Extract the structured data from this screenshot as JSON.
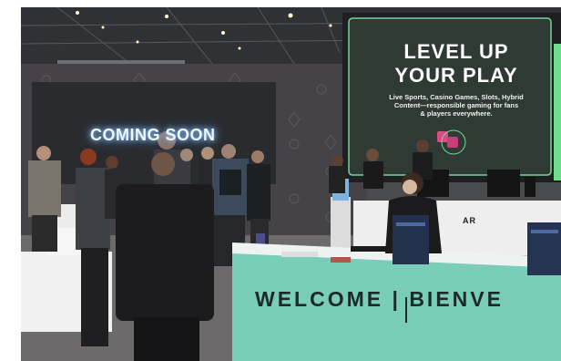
{
  "photo": {
    "left_screen": "COMING SOON",
    "right_screen": {
      "headline_line1": "LEVEL UP",
      "headline_line2": "YOUR PLAY",
      "subline_1": "Live Sports, Casino Games, Slots, Hybrid",
      "subline_2": "Content—responsible gaming for fans",
      "subline_3": "& players everywhere."
    },
    "welcome_counter": "WELCOME | BIENVE",
    "back_counter_fragment": "AR"
  }
}
